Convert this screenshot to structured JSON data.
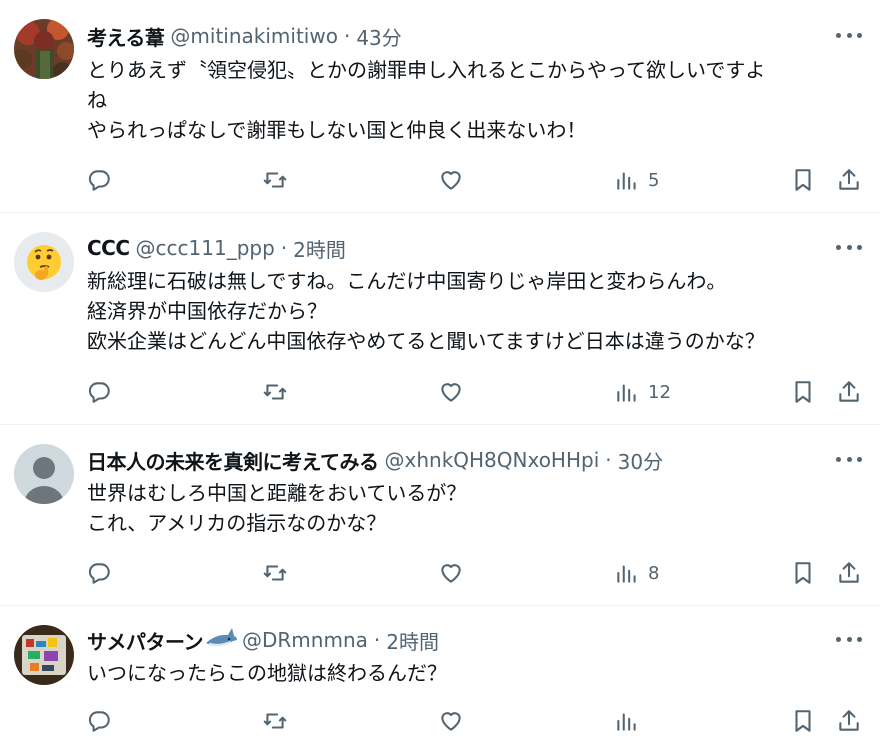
{
  "posts": [
    {
      "name": "考える葦",
      "handle": "@mitinakimitiwo",
      "separator": "·",
      "time": "43分",
      "lines": [
        "とりあえず〝領空侵犯〟とかの謝罪申し入れるとこからやって欲しいですよ",
        "ね",
        "やられっぱなしで謝罪もしない国と仲良く出来ないわ！"
      ],
      "views": "5"
    },
    {
      "name": "CCC",
      "handle": "@ccc111_ppp",
      "separator": "·",
      "time": "2時間",
      "lines": [
        "新総理に石破は無しですね。こんだけ中国寄りじゃ岸田と変わらんわ。",
        "経済界が中国依存だから？",
        "欧米企業はどんどん中国依存やめてると聞いてますけど日本は違うのかな？"
      ],
      "views": "12"
    },
    {
      "name": "日本人の未来を真剣に考えてみる",
      "handle": "@xhnkQH8QNxoHHpi",
      "separator": "·",
      "time": "30分",
      "lines": [
        "世界はむしろ中国と距離をおいているが？",
        "これ、アメリカの指示なのかな？"
      ],
      "views": "8"
    },
    {
      "name": "サメパターン",
      "name_emoji": "shark-emoji",
      "handle": "@DRmnmna",
      "separator": "·",
      "time": "2時間",
      "lines": [
        "いつになったらこの地獄は終わるんだ？"
      ],
      "views": ""
    }
  ],
  "icons": {
    "reply": "reply-icon",
    "retweet": "retweet-icon",
    "like": "heart-icon",
    "views": "views-icon",
    "bookmark": "bookmark-icon",
    "share": "share-icon",
    "more": "more-icon"
  },
  "colors": {
    "text": "#0f1419",
    "secondary": "#536471",
    "divider": "#eff3f4"
  }
}
